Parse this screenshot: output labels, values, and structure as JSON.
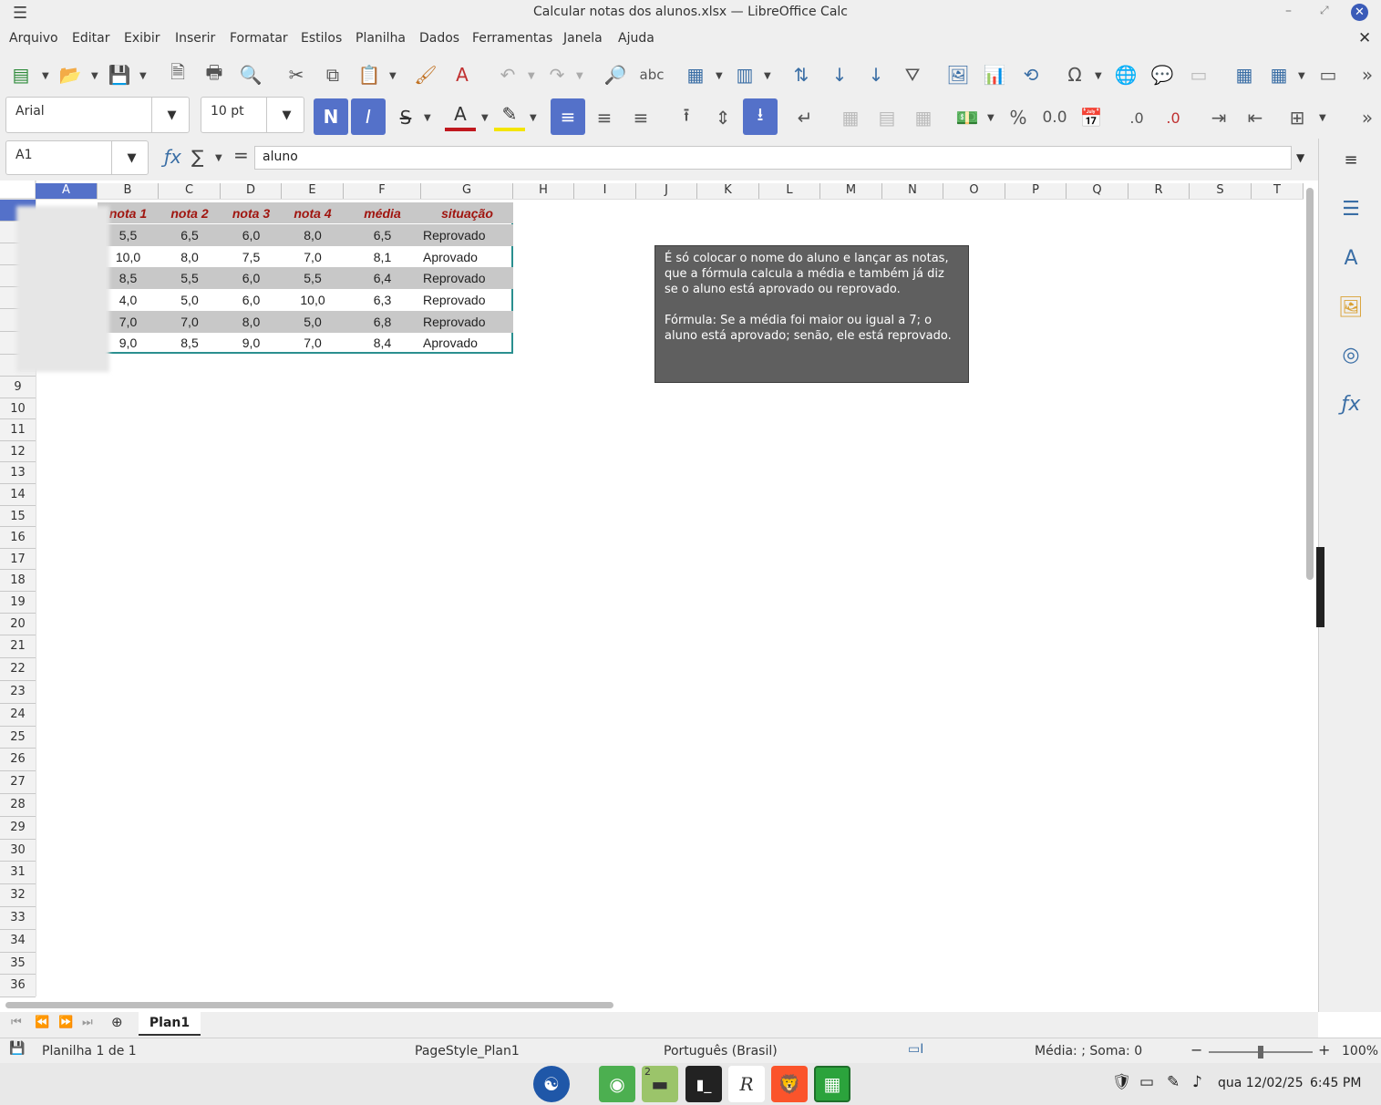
{
  "window": {
    "title": "Calcular notas dos alunos.xlsx — LibreOffice Calc"
  },
  "menu": [
    "Arquivo",
    "Editar",
    "Exibir",
    "Inserir",
    "Formatar",
    "Estilos",
    "Planilha",
    "Dados",
    "Ferramentas",
    "Janela",
    "Ajuda"
  ],
  "format": {
    "font_name": "Arial",
    "font_size": "10 pt",
    "bold": "N",
    "italic": "I",
    "strike": "S",
    "percent": "%",
    "number": "0.0"
  },
  "formula": {
    "cell_ref": "A1",
    "content": "aluno"
  },
  "columns": [
    "A",
    "B",
    "C",
    "D",
    "E",
    "F",
    "G",
    "H",
    "I",
    "J",
    "K",
    "L",
    "M",
    "N",
    "O",
    "P",
    "Q",
    "R",
    "S",
    "T"
  ],
  "rows_start": 9,
  "rows_end": 36,
  "table": {
    "headers": [
      "nota 1",
      "nota 2",
      "nota 3",
      "nota 4",
      "média",
      "situação"
    ],
    "rows": [
      [
        "5,5",
        "6,5",
        "6,0",
        "8,0",
        "6,5",
        "Reprovado"
      ],
      [
        "10,0",
        "8,0",
        "7,5",
        "7,0",
        "8,1",
        "Aprovado"
      ],
      [
        "8,5",
        "5,5",
        "6,0",
        "5,5",
        "6,4",
        "Reprovado"
      ],
      [
        "4,0",
        "5,0",
        "6,0",
        "10,0",
        "6,3",
        "Reprovado"
      ],
      [
        "7,0",
        "7,0",
        "8,0",
        "5,0",
        "6,8",
        "Reprovado"
      ],
      [
        "9,0",
        "8,5",
        "9,0",
        "7,0",
        "8,4",
        "Aprovado"
      ]
    ]
  },
  "note": {
    "line1": "É só colocar o nome do aluno e lançar as notas, que a fórmula calcula a média e também já diz se o aluno está aprovado ou reprovado.",
    "line2": "Fórmula: Se a média foi maior ou igual a 7; o aluno está aprovado; senão, ele está reprovado."
  },
  "sheet_tab": "Plan1",
  "status": {
    "sheet": "Planilha 1 de 1",
    "page_style": "PageStyle_Plan1",
    "language": "Português (Brasil)",
    "summary": "Média: ; Soma: 0",
    "zoom": "100%"
  },
  "taskbar": {
    "datetime": "qua 12/02/25",
    "time": "6:45 PM",
    "badge": "2"
  },
  "colors": {
    "accent": "#5471c9",
    "header_text": "#a0150f",
    "note_bg": "#5f5f5f",
    "stripe": "#c8c8c8"
  }
}
